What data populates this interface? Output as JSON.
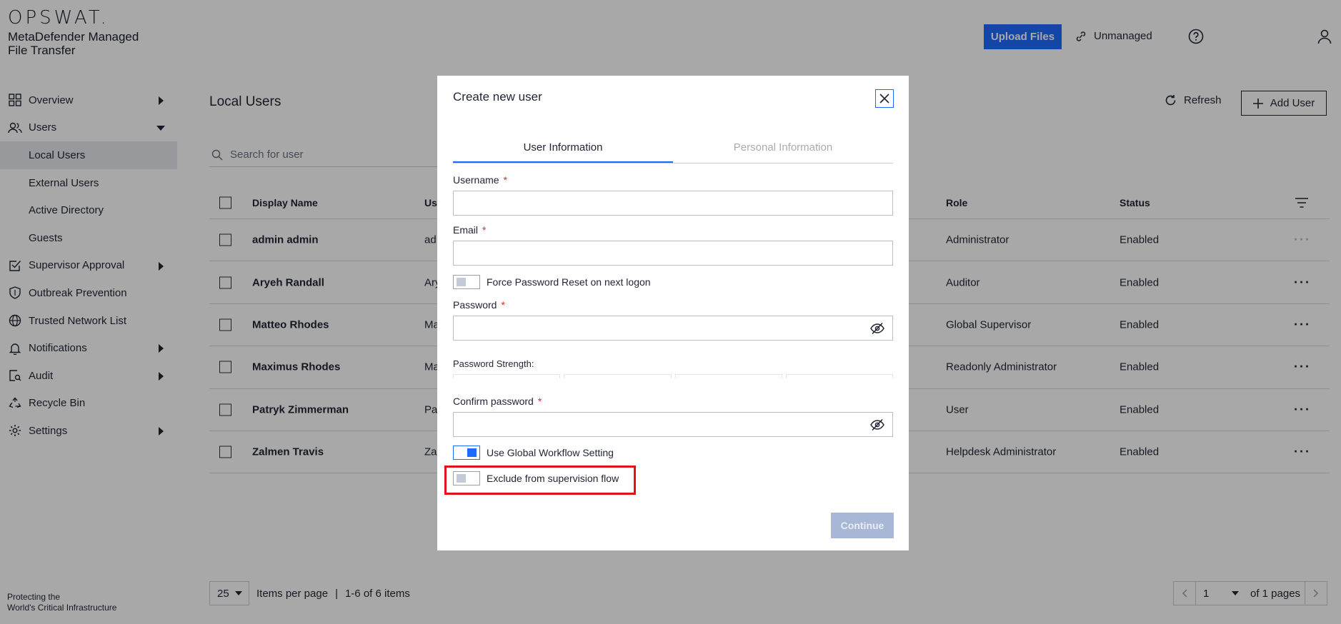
{
  "header": {
    "logo_text": "OPSWAT.",
    "product_name": "MetaDefender Managed File Transfer",
    "upload_label": "Upload Files",
    "unmanaged_label": "Unmanaged"
  },
  "sidebar": {
    "items": [
      {
        "label": "Overview",
        "icon": "grid-icon",
        "arrow": "right"
      },
      {
        "label": "Users",
        "icon": "users-icon",
        "arrow": "down"
      },
      {
        "label": "Supervisor Approval",
        "icon": "checkbox-icon",
        "arrow": "right"
      },
      {
        "label": "Outbreak Prevention",
        "icon": "shield-icon",
        "arrow": "none"
      },
      {
        "label": "Trusted Network List",
        "icon": "globe-icon",
        "arrow": "none"
      },
      {
        "label": "Notifications",
        "icon": "bell-icon",
        "arrow": "right"
      },
      {
        "label": "Audit",
        "icon": "audit-icon",
        "arrow": "right"
      },
      {
        "label": "Recycle Bin",
        "icon": "recycle-icon",
        "arrow": "none"
      },
      {
        "label": "Settings",
        "icon": "gear-icon",
        "arrow": "right"
      }
    ],
    "user_subitems": [
      "Local Users",
      "External Users",
      "Active Directory",
      "Guests"
    ],
    "active_subitem": "Local Users",
    "footer_line1": "Protecting the",
    "footer_line2": "World's Critical Infrastructure"
  },
  "main": {
    "title": "Local Users",
    "refresh_label": "Refresh",
    "add_user_label": "Add User",
    "search_placeholder": "Search for user",
    "columns": {
      "display_name": "Display Name",
      "username": "Us",
      "role": "Role",
      "status": "Status"
    },
    "rows": [
      {
        "name": "admin admin",
        "user": "ad",
        "role": "Administrator",
        "status": "Enabled"
      },
      {
        "name": "Aryeh Randall",
        "user": "Ary",
        "role": "Auditor",
        "status": "Enabled"
      },
      {
        "name": "Matteo Rhodes",
        "user": "Ma",
        "role": "Global Supervisor",
        "status": "Enabled"
      },
      {
        "name": "Maximus Rhodes",
        "user": "Ma",
        "role": "Readonly Administrator",
        "status": "Enabled"
      },
      {
        "name": "Patryk Zimmerman",
        "user": "Pa",
        "role": "User",
        "status": "Enabled"
      },
      {
        "name": "Zalmen Travis",
        "user": "Za",
        "role": "Helpdesk Administrator",
        "status": "Enabled"
      }
    ],
    "more_label": "···",
    "per_page_value": "25",
    "per_page_label": "Items per page",
    "separator": "|",
    "items_count": "1-6 of 6 items",
    "page_value": "1",
    "pages_label": "of 1 pages"
  },
  "modal": {
    "title": "Create new user",
    "tabs": [
      "User Information",
      "Personal Information"
    ],
    "username_label": "Username",
    "email_label": "Email",
    "required_mark": "*",
    "force_reset_label": "Force Password Reset on next logon",
    "password_label": "Password",
    "strength_label": "Password Strength:",
    "confirm_label": "Confirm password",
    "global_workflow_label": "Use Global Workflow Setting",
    "exclude_label": "Exclude from supervision flow",
    "continue_label": "Continue"
  },
  "colors": {
    "accent": "#1d6bfc",
    "highlight": "#e0111b",
    "required": "#e0252c"
  }
}
